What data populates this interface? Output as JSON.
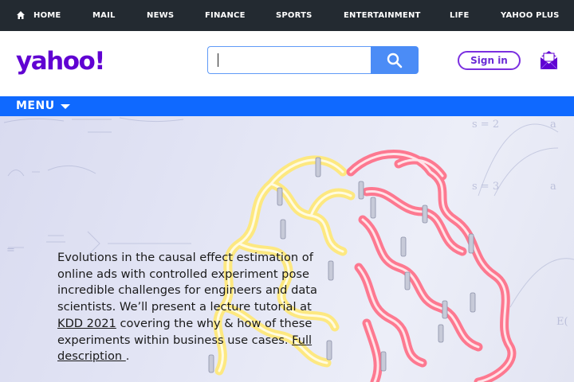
{
  "topnav": {
    "items": [
      {
        "label": "HOME",
        "icon": "home-icon"
      },
      {
        "label": "MAIL"
      },
      {
        "label": "NEWS"
      },
      {
        "label": "FINANCE"
      },
      {
        "label": "SPORTS"
      },
      {
        "label": "ENTERTAINMENT"
      },
      {
        "label": "LIFE"
      },
      {
        "label": "YAHOO PLUS"
      }
    ]
  },
  "header": {
    "logo_text": "yahoo!",
    "search_value": "",
    "signin_label": "Sign in"
  },
  "menubar": {
    "menu_label": "MENU"
  },
  "hero": {
    "text_before_link": "Evolutions in the causal effect estimation of online ads with controlled experiment pose incredible challenges for engineers and data scientists. We’ll present a lecture tutorial at ",
    "link1": "KDD 2021",
    "text_middle": " covering the why & how of these experiments within business use cases. ",
    "link2": "Full description ",
    "text_after": "."
  },
  "colors": {
    "topnav_bg": "#232a31",
    "brand_purple": "#6001d2",
    "menubar_bg": "#0f69ff",
    "search_button": "#4b8cf6"
  }
}
